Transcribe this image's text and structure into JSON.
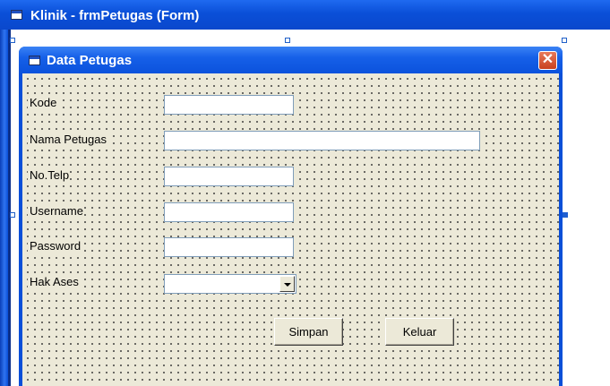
{
  "designer": {
    "title": "Klinik - frmPetugas (Form)"
  },
  "form": {
    "title": "Data Petugas",
    "close_glyph": "✕"
  },
  "fields": {
    "kode_label": "Kode",
    "nama_label": "Nama Petugas",
    "telp_label": "No.Telp",
    "username_label": "Username",
    "password_label": "Password",
    "hak_ases_label": "Hak Ases"
  },
  "inputs": {
    "kode_value": "",
    "nama_value": "",
    "telp_value": "",
    "username_value": "",
    "password_value": "",
    "hak_ases_selected": ""
  },
  "buttons": {
    "simpan_label": "Simpan",
    "keluar_label": "Keluar"
  },
  "icons": {
    "window_icon": "form-window-icon",
    "dropdown_icon": "chevron-down-icon",
    "close_icon": "close-icon"
  },
  "colors": {
    "title_bar_blue": "#0a4fd8",
    "form_background": "#ece9d8",
    "close_button_red": "#d9542f"
  }
}
